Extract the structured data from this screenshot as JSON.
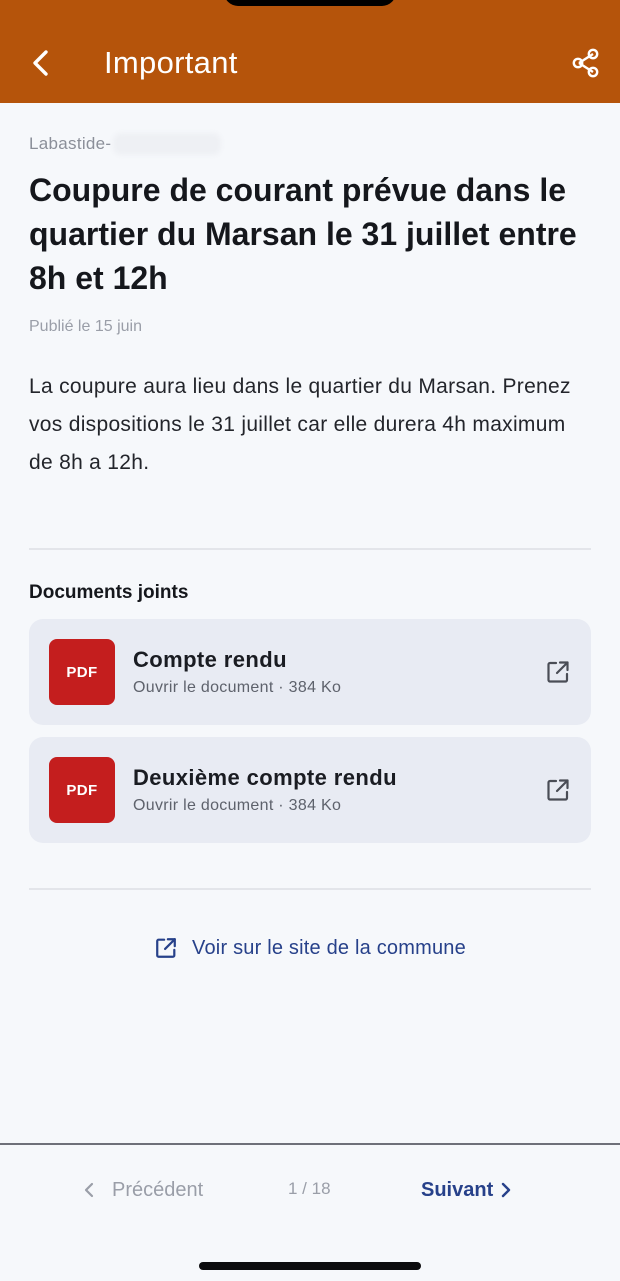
{
  "header": {
    "title": "Important",
    "background_color": "#b5540b"
  },
  "article": {
    "commune_prefix": "Labastide-",
    "title": "Coupure de courant prévue dans le quartier du Marsan le 31 juillet entre 8h et 12h",
    "published": "Publié le 15 juin",
    "body": "La coupure aura lieu dans le quartier du Marsan. Prenez vos dispositions le 31 juillet car elle durera 4h maximum de 8h a 12h."
  },
  "documents": {
    "section_title": "Documents joints",
    "items": [
      {
        "badge": "PDF",
        "title": "Compte rendu",
        "meta": "Ouvrir le document · 384 Ko"
      },
      {
        "badge": "PDF",
        "title": "Deuxième compte rendu",
        "meta": "Ouvrir le document · 384 Ko"
      }
    ]
  },
  "site_link": {
    "label": "Voir sur le site de la commune"
  },
  "pagination": {
    "prev_label": "Précédent",
    "page_indicator": "1 / 18",
    "next_label": "Suivant"
  },
  "icons": {
    "back": "chevron-left-icon",
    "share": "share-icon",
    "external": "external-link-icon",
    "prev": "chevron-left-icon",
    "next": "chevron-right-icon"
  },
  "colors": {
    "accent_blue": "#27418a",
    "pdf_red": "#c41e1e"
  }
}
